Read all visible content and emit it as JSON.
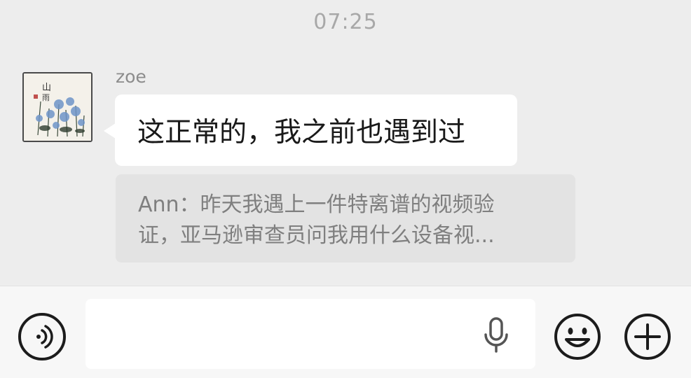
{
  "chat": {
    "timestamp": "07:25",
    "message": {
      "sender_name": "zoe",
      "avatar_icon": "ink-painting-avatar",
      "text": "这正常的，我之前也遇到过",
      "quote": {
        "line1": "Ann：昨天我遇上一件特离谱的视频验",
        "line2": "证，亚马逊审查员问我用什么设备视..."
      }
    }
  },
  "input_bar": {
    "voice_icon": "voice-input-icon",
    "text_value": "",
    "mic_icon": "microphone-icon",
    "emoji_icon": "emoji-icon",
    "plus_icon": "plus-icon"
  },
  "colors": {
    "chat_background": "#ededed",
    "bubble": "#ffffff",
    "quote_background": "#e3e3e3",
    "timestamp_text": "#a8a8a8",
    "icon_stroke": "#1c1c1c"
  }
}
